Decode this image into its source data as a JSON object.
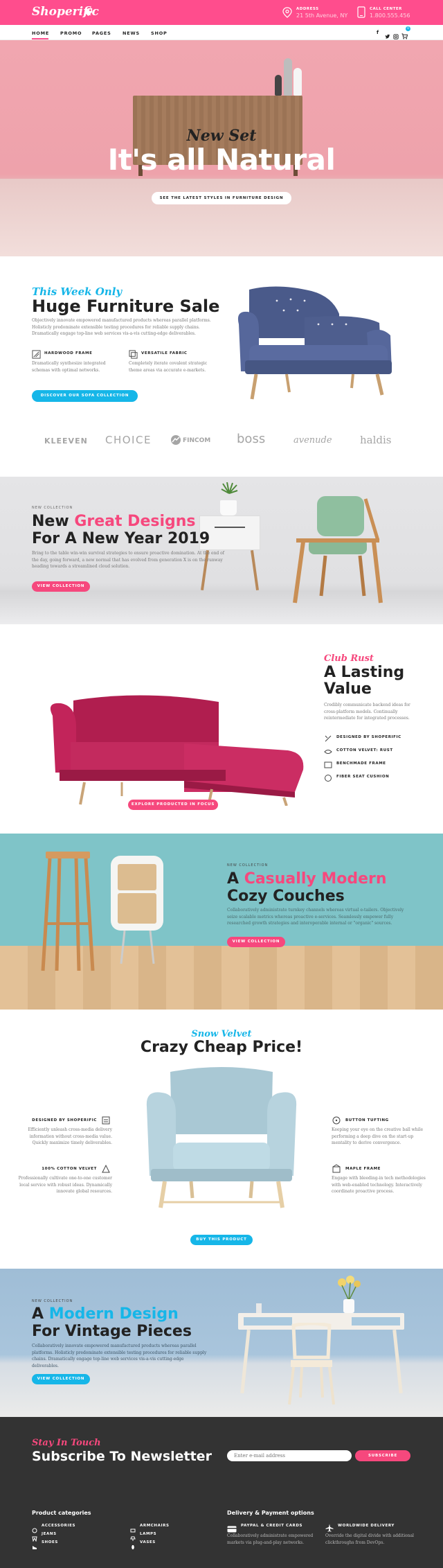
{
  "header": {
    "logo": "Shoperific",
    "address_label": "ADDRESS",
    "address_value": "21 5th Avenue, NY",
    "call_label": "CALL CENTER",
    "call_value": "1.800.555.456",
    "brand_color": "#ff4d8d"
  },
  "nav": {
    "items": [
      "HOME",
      "PROMO",
      "PAGES",
      "NEWS",
      "SHOP"
    ],
    "cart_count": "0"
  },
  "hero": {
    "script": "New Set",
    "title": "It's all Natural",
    "button": "SEE THE LATEST STYLES IN FURNITURE DESIGN"
  },
  "sale": {
    "script": "This Week Only",
    "title": "Huge Furniture Sale",
    "text": "Objectively innovate empowered manufactured products whereas parallel platforms. Holisticly predominate extensible testing procedures for reliable supply chains. Dramatically engage top-line web services vis-a-vis cutting-edge deliverables.",
    "feature1_title": "HARDWOOD FRAME",
    "feature1_text": "Dramatically synthesize integrated schemas with optimal networks.",
    "feature2_title": "VERSATILE FABRIC",
    "feature2_text": "Completely iterate covalent strategic theme areas via accurate e-markets.",
    "button": "DISCOVER OUR SOFA COLLECTION"
  },
  "brands": [
    "KLEEVEN",
    "CHOICE",
    "FINCOM",
    "boss",
    "avenude",
    "haldis"
  ],
  "newyear": {
    "label": "NEW COLLECTION",
    "title_a": "New ",
    "title_b": "Great Designs",
    "title_c": "For A New Year 2019",
    "text": "Bring to the table win-win survival strategies to ensure proactive domination. At the end of the day, going forward, a new normal that has evolved from generation X is on the runway heading towards a streamlined cloud solution.",
    "button": "VIEW COLLECTION"
  },
  "clubrust": {
    "script": "Club Rust",
    "title": "A Lasting Value",
    "text": "Credibly communicate backend ideas for cross-platform models. Continually reintermediate for integrated processes.",
    "features": [
      "DESIGNED BY SHOPERIFIC",
      "COTTON VELVET: RUST",
      "BENCHMADE FRAME",
      "FIBER SEAT CUSHION"
    ],
    "button": "EXPLORE PRODUCTED IN FOCUS"
  },
  "couches": {
    "label": "NEW COLLECTION",
    "title_a": "A ",
    "title_b": "Casually Modern",
    "title_c": "Cozy Couches",
    "text": "Collaboratively administrate turnkey channels whereas virtual e-tailers. Objectively seize scalable metrics whereas proactive e-services. Seamlessly empower fully researched growth strategies and interoperable internal or \"organic\" sources.",
    "button": "VIEW COLLECTION"
  },
  "snow": {
    "script": "Snow Velvet",
    "title": "Crazy Cheap Price!",
    "left": [
      {
        "title": "DESIGNED BY SHOPERIFIC",
        "text": "Efficiently unleash cross-media delivery information without cross-media value. Quickly maximize timely deliverables."
      },
      {
        "title": "100% COTTON VELVET",
        "text": "Professionally cultivate one-to-one customer local service with robust ideas. Dynamically innovate global resources."
      }
    ],
    "right": [
      {
        "title": "BUTTON TUFTING",
        "text": "Keeping your eye on the creative ball while performing a deep dive on the start-up mentality to derive convergence."
      },
      {
        "title": "MAPLE FRAME",
        "text": "Engage with bleeding-in tech methodologies with web-enabled technology. Interactively coordinate proactive process."
      }
    ],
    "button": "BUY THIS PRODUCT"
  },
  "vintage": {
    "label": "NEW COLLECTION",
    "title_a": "A ",
    "title_b": "Modern Design",
    "title_c": "For Vintage Pieces",
    "text": "Collaboratively innovate empowered manufactured products whereas parallel platforms. Holisticly predominate extensible testing procedures for reliable supply chains. Dramatically engage top-line web services vis-a-vis cutting-edge deliverables.",
    "button": "VIEW COLLECTION"
  },
  "footer": {
    "script": "Stay In Touch",
    "title": "Subscribe To Newsletter",
    "email_placeholder": "Enter e-mail address",
    "subscribe": "SUBSCRIBE",
    "cat_heading": "Product categories",
    "cats": [
      "ACCESSORIES",
      "JEANS",
      "SHOES",
      "ARMCHAIRS",
      "LAMPS",
      "VASES"
    ],
    "del_heading": "Delivery & Payment options",
    "pay_title": "PAYPAL & CREDIT CARDS",
    "pay_text": "Collaboratively administrate empowered markets via plug-and-play networks.",
    "ship_title": "WORLDWIDE DELIVERY",
    "ship_text": "Override the digital divide with additional clickthroughs from DevOps."
  }
}
